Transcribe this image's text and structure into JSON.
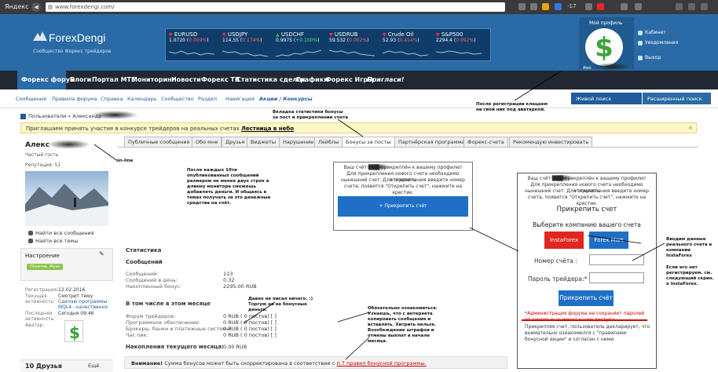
{
  "browser": {
    "brand": "Яндекс",
    "url": "www.forexdengi.com/",
    "temp": "-17"
  },
  "header": {
    "logo": "ForexDengi",
    "logo_sub": "Сообщество Форекс трейдеров",
    "profile_title": "Мой профиль",
    "profile_links": [
      "Кабинет",
      "Уведомления",
      "Выход"
    ],
    "avatar_name": "Alex"
  },
  "ticker": [
    {
      "name": "EURUSD",
      "value": "1.0720",
      "change": "0.009%",
      "up": false
    },
    {
      "name": "USDJPY",
      "value": "114.55",
      "change": "0.174%",
      "up": false
    },
    {
      "name": "USDCHF",
      "value": "0.9975",
      "change": "+0.100%",
      "up": true
    },
    {
      "name": "USDRUB",
      "value": "59.532",
      "change": "0.002%",
      "up": false
    },
    {
      "name": "Crude Oil",
      "value": "52.93",
      "change": "0.414%",
      "up": false
    },
    {
      "name": "S&P500",
      "value": "2294.4",
      "change": "0.092%",
      "up": false
    }
  ],
  "darknav": [
    "Форекс форум",
    "Блоги",
    "Портал MT5",
    "Мониторинг",
    "Новости",
    "Форекс ТВ",
    "Статистика сделок",
    "Графики",
    "Форекс Игры",
    "Пригласи!"
  ],
  "subnav": [
    "Сообщения",
    "Правила форума",
    "Справка",
    "Календарь",
    "Сообщество",
    "Раздел",
    "Навигация",
    "Акции / Конкурсы"
  ],
  "search": {
    "live": "Живой поиск",
    "advanced": "Расширенный поиск"
  },
  "breadcrumb": {
    "root": "Пользователи",
    "current": "Александр"
  },
  "banner": {
    "text": "Приглашаем принять участие в конкурсе трейдеров на реальных счетах",
    "link": "Лестница в небо",
    "close": "×"
  },
  "user": {
    "name": "Алекс",
    "status": "Частый гость",
    "reputation": "Репутация: 51",
    "links": [
      "Найти все сообщения",
      "Найти все темы"
    ],
    "mood_title": "Настроение",
    "mood_badge": "Позитив. Муза",
    "info": [
      {
        "label": "Регистрация:",
        "value": "12.02.2016"
      },
      {
        "label": "Текущая",
        "value": "Смотрит тему"
      },
      {
        "label": "активность:",
        "value": "Сделаю программы"
      },
      {
        "label": "",
        "value": "MQL4 - качественно"
      },
      {
        "label": "Последняя",
        "value": "Сегодня 09:46"
      },
      {
        "label": "активность:",
        "value": ""
      },
      {
        "label": "Аватар:",
        "value": ""
      }
    ],
    "friends": "10 Друзья",
    "friends_all": "Ещё"
  },
  "tabs": [
    {
      "label": "Публичные сообщения",
      "active": false
    },
    {
      "label": "Обо мне",
      "active": false
    },
    {
      "label": "Друзья",
      "active": false
    },
    {
      "label": "Виджеты",
      "active": false
    },
    {
      "label": "Нарушение",
      "active": false
    },
    {
      "label": "Лейблы",
      "active": false
    },
    {
      "label": "Бонусы за посты",
      "active": true
    },
    {
      "label": "Партнёрская программа",
      "active": false
    },
    {
      "label": "Форекс-счета",
      "active": false
    },
    {
      "label": "Рекомендую инвестировать",
      "active": false
    }
  ],
  "popup_center": {
    "lines": [
      "Ваш счёт",
      "прикреплён к вашему профилю!",
      "Для прикрепления нового счета необходимо открепить",
      "нынешний счет. Для открепления введите номер",
      "счета, появится \"Открепить счет\", нажмите на крестик."
    ],
    "button": "+ Прикрепить счёт"
  },
  "popup_right": {
    "lines": [
      "Ваш счёт",
      "прикреплён к вашему профилю!",
      "Для прикрепления нового счета необходимо открепить",
      "нынешний счет. Для открепления введите номер",
      "счета, появится \"Открепить счет\", нажмите на крестик."
    ],
    "title": "Прикрепить счет",
    "subtitle": "Выберите компанию вашего счета",
    "broker1": "InstaForex",
    "broker2": "Forex Mart",
    "num_label": "Номер счёта :",
    "pass_label": "Пароль трейдера:*",
    "submit": "Прикрепить счёт",
    "note": "*Администрация форума не сохраняет паролей от счетов и не имеет к ним доступа.",
    "footer": "Прикрепляя счет, пользователь декларирует, что внимательно ознакомился с \"правилами бонусной акции\" и согласен с ними."
  },
  "stats": {
    "title": "Статистика",
    "messages_title": "Сообщений",
    "rows": [
      {
        "label": "Сообщений:",
        "value": "113"
      },
      {
        "label": "Сообщений в день:",
        "value": "0.32"
      },
      {
        "label": "Накопленный бонус:",
        "value": "2295.00 RUB"
      }
    ],
    "month_title": "В том числе в этом месяце",
    "month_rows": [
      {
        "label": "Форум трейдеров:",
        "value": "0 RUB ( 0 постов) [ ]"
      },
      {
        "label": "Программное обеспечение:",
        "value": "0 RUB ( 0 постов) [ ]"
      },
      {
        "label": "Брокеры, банки и платежные системы:",
        "value": "0 RUB ( 0 постов) [ ]"
      },
      {
        "label": "Час пик:",
        "value": "0 RUB ( 0 постов) [ ]"
      }
    ],
    "accum_title": "Накопления текущего месяца:",
    "accum_value": "0.00 RUB"
  },
  "warning": {
    "bold": "Внимание!",
    "text": "Сумма бонусов может быть скорректирована в соответствии с",
    "link": "п.7 правил бонусной программы."
  },
  "annotations": {
    "tab": "Вкладка статистики бонусы за пост и прикрепление счета",
    "avatar": "После регистрации клацаем на свой ник под аватаркой.",
    "online": "on-line",
    "posts": "После каждых 10ти опубликованных сообщений размером не менее двух строк в длинну монитора сможешь добавлять деньги. И общаясь в темах получать за это денежные средства на счёт.",
    "nobonus": "Давно не писал ничего. :) Торгую на не бонусные деньги.",
    "copy": "Обязательно ознакомиться. Узнаешь, что с интернета копировать сообщения и вставлять. Хитрить нельзя.",
    "fines": "Возобеждение штрафов и отмены выплат в начале месяца.",
    "insta": "Вводим данные реального счета в компании InstaForex",
    "noreg": "Если его нет регистрируем. см. следующий скрин. о InstaForex."
  },
  "colors": {
    "header": "#2a6aa6",
    "darknav": "#1f2833",
    "accent": "#1f6fc7",
    "insta": "#e0261f",
    "banner": "#fff7c8"
  }
}
